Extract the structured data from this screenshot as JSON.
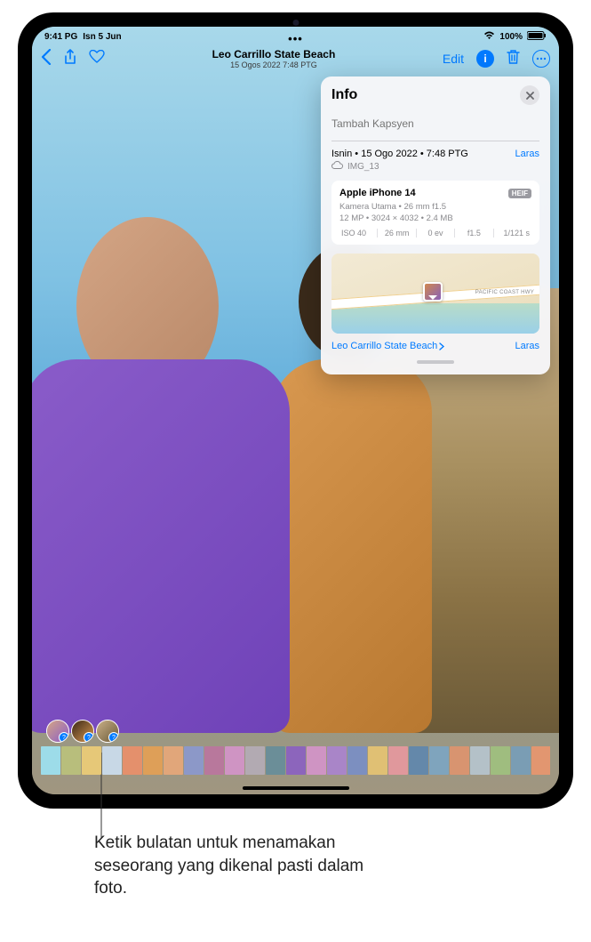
{
  "status_bar": {
    "time": "9:41 PG",
    "date": "Isn 5 Jun",
    "battery_pct": "100%"
  },
  "nav": {
    "title": "Leo Carrillo State Beach",
    "subtitle": "15 Ogos 2022 7:48 PTG",
    "edit_label": "Edit"
  },
  "info_panel": {
    "title": "Info",
    "caption_placeholder": "Tambah Kapsyen",
    "date_line": "Isnin • 15 Ogo 2022 • 7:48 PTG",
    "adjust_label": "Laras",
    "filename": "IMG_13",
    "device": "Apple iPhone 14",
    "format_badge": "HEIF",
    "camera_line": "Kamera Utama • 26 mm f1.5",
    "resolution_line": "12 MP • 3024 × 4032 • 2.4 MB",
    "specs": {
      "iso": "ISO 40",
      "focal": "26 mm",
      "ev": "0 ev",
      "aperture": "f1.5",
      "shutter": "1/121 s"
    },
    "map_road": "PACIFIC COAST HWY",
    "location_name": "Leo Carrillo State Beach",
    "location_adjust": "Laras"
  },
  "callout": "Ketik bulatan untuk menamakan seseorang yang dikenal pasti dalam foto.",
  "thumb_colors": [
    "#9ddce9",
    "#b8be7c",
    "#e6c878",
    "#c8d8e6",
    "#e4906c",
    "#de9f58",
    "#e1a67a",
    "#8c98c8",
    "#b8789c",
    "#cf94c3",
    "#b2aab2",
    "#6b8e98",
    "#8c65bc",
    "#cf94c3",
    "#a985c8",
    "#7c8fc0",
    "#e0c074",
    "#e0989c",
    "#6488aa",
    "#7fa4bd",
    "#d89470",
    "#b4c1c8",
    "#9fbd7f",
    "#7a9db4",
    "#e29670",
    "#9aaec0"
  ]
}
